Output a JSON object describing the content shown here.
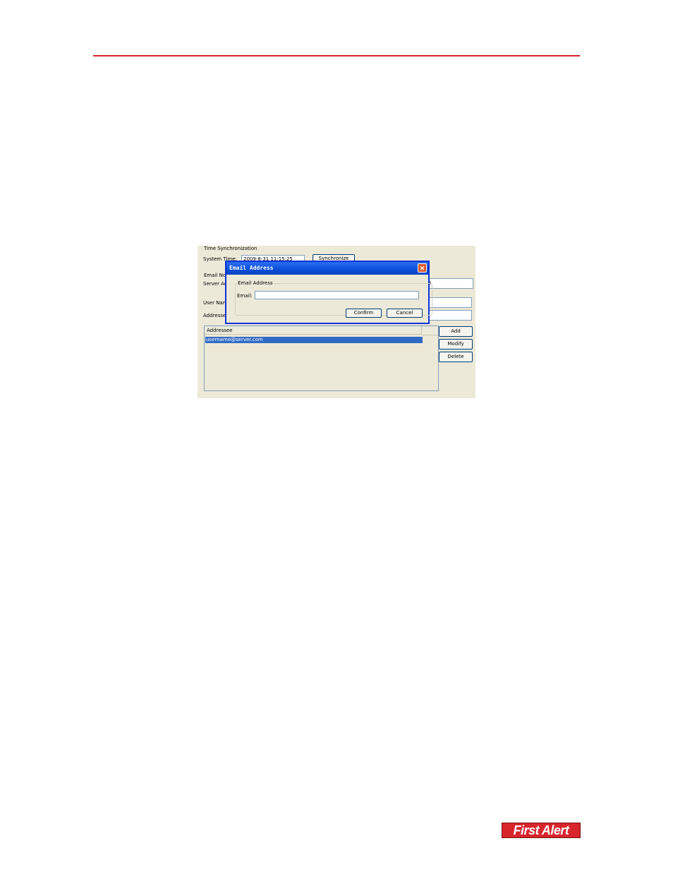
{
  "screenshot": {
    "time_sync": {
      "group_label": "Time Synchronization",
      "system_time_label": "System Time:",
      "system_time_value": "2009-8-31 11:15:25",
      "synchronize_label": "Synchronize"
    },
    "email_notification": {
      "group_label": "Email Noti",
      "server_label": "Server Ac",
      "server_value": "5",
      "user_label": "User Nam",
      "addressee_label": "Addresse"
    },
    "addressee_list": {
      "column_header": "Addressee",
      "items": [
        "username@server.com"
      ]
    },
    "buttons": {
      "add": "Add",
      "modify": "Modify",
      "delete": "Delete"
    },
    "dialog": {
      "title": "Email Address",
      "group_label": "Email Address",
      "email_label": "Email:",
      "email_value": "",
      "confirm_label": "Confirm",
      "cancel_label": "Cancel"
    }
  },
  "logo": {
    "text": "First Alert"
  },
  "colors": {
    "accent_rule": "#d8252c",
    "selection": "#316ac5",
    "titlebar": "#0a4ed8"
  }
}
